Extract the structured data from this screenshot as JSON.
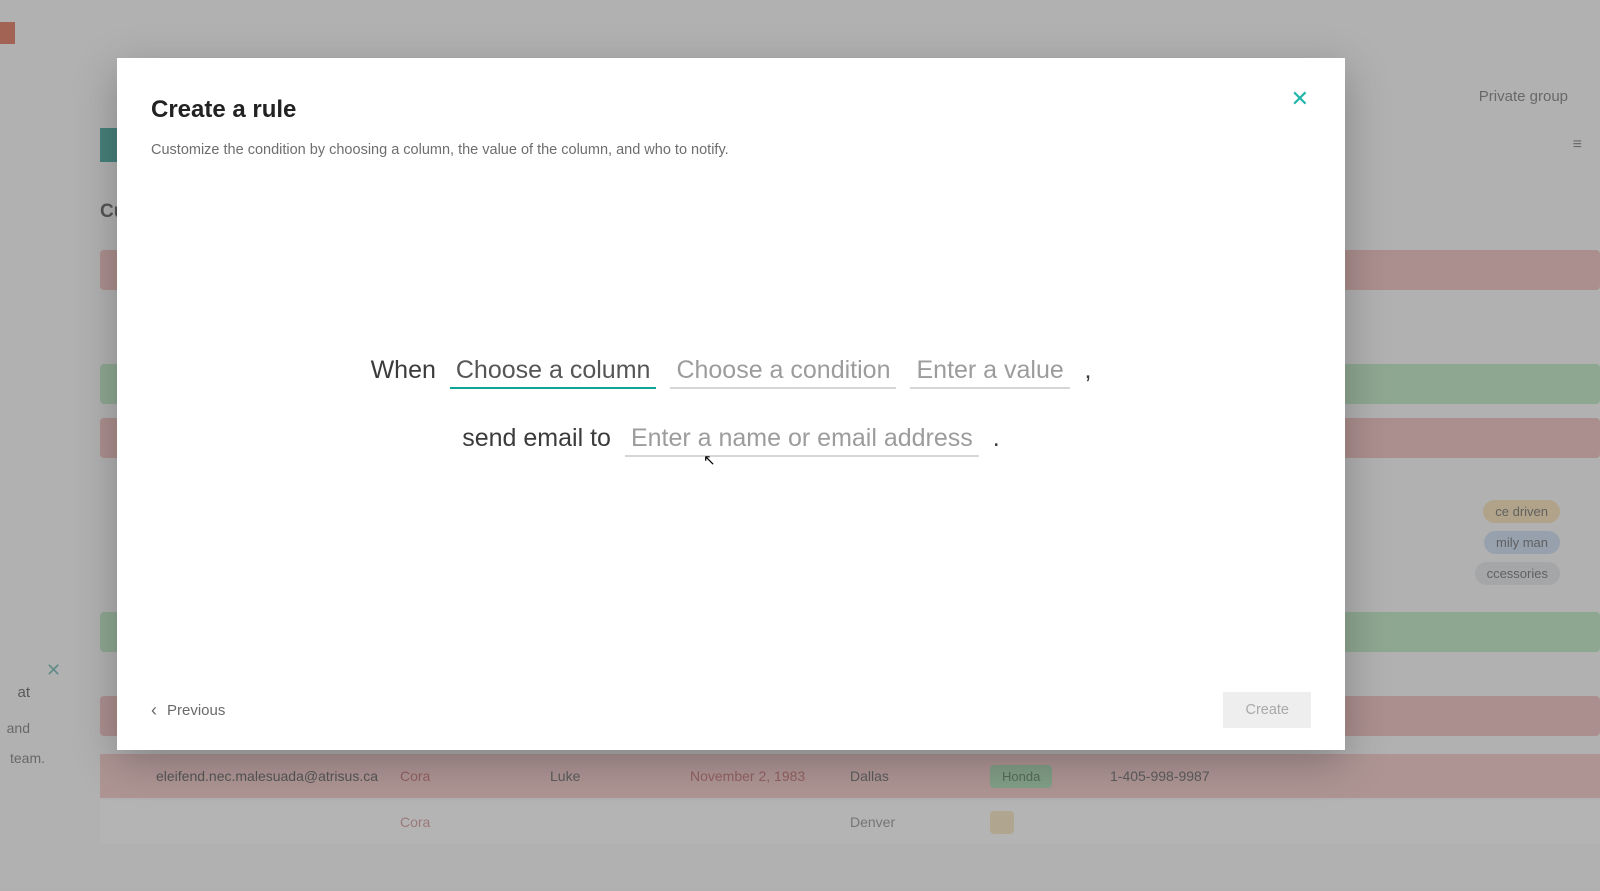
{
  "page": {
    "private_group_label": "Private group",
    "truncated_heading": "Cu",
    "side_fragment": {
      "line1": "at",
      "line2": "and",
      "line3": "team."
    },
    "pills": {
      "orange": "ce driven",
      "blue": "mily man",
      "gray": "ccessories"
    },
    "rows": [
      {
        "email": "eleifend.nec.malesuada@atrisus.ca",
        "first": "Cora",
        "last": "Luke",
        "date": "November 2, 1983",
        "city": "Dallas",
        "badge": "Honda",
        "phone": "1-405-998-9987"
      },
      {
        "email": "",
        "first": "Cora",
        "last": "",
        "date": "",
        "city": "Denver",
        "badge": "",
        "phone": ""
      }
    ]
  },
  "modal": {
    "title": "Create a rule",
    "subtitle": "Customize the condition by choosing a column, the value of the column, and who to notify.",
    "when_label": "When",
    "col_placeholder": "Choose a column",
    "cond_placeholder": "Choose a condition",
    "val_placeholder": "Enter a value",
    "send_label": "send email to",
    "email_placeholder": "Enter a name or email address",
    "previous_label": "Previous",
    "create_label": "Create"
  }
}
